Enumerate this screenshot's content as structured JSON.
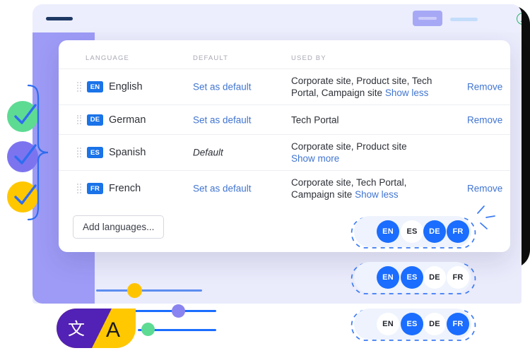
{
  "browser": {
    "logo_icon": "nav-logo-placeholder",
    "primary_button_icon": "primary-action-placeholder",
    "secondary_line_icon": "secondary-link-placeholder",
    "avatar_icon": "user-avatar-icon"
  },
  "card": {
    "columns": {
      "language": "LANGUAGE",
      "default": "DEFAULT",
      "used_by": "USED BY"
    },
    "rows": [
      {
        "code": "EN",
        "name": "English",
        "default_label": "Set as default",
        "default_is_current": false,
        "used_by": "Corporate site, Product site, Tech Portal, Campaign site",
        "toggle_label": "Show less",
        "remove_label": "Remove",
        "has_remove": true
      },
      {
        "code": "DE",
        "name": "German",
        "default_label": "Set as default",
        "default_is_current": false,
        "used_by": "Tech Portal",
        "toggle_label": "",
        "remove_label": "Remove",
        "has_remove": true
      },
      {
        "code": "ES",
        "name": "Spanish",
        "default_label": "Default",
        "default_is_current": true,
        "used_by": "Corporate site, Product site",
        "toggle_label": "Show more",
        "remove_label": "",
        "has_remove": false
      },
      {
        "code": "FR",
        "name": "French",
        "default_label": "Set as default",
        "default_is_current": false,
        "used_by": "Corporate site, Tech Portal, Campaign site",
        "toggle_label": "Show less",
        "remove_label": "Remove",
        "has_remove": true
      }
    ],
    "add_languages_label": "Add languages..."
  },
  "checks": [
    {
      "icon": "check-circle-icon",
      "color": "#5ddb93"
    },
    {
      "icon": "check-circle-icon",
      "color": "#7c74ef"
    },
    {
      "icon": "check-circle-icon",
      "color": "#ffc700"
    }
  ],
  "sliders": [
    {
      "icon": "slider-knob-icon",
      "color": "#ffc400"
    },
    {
      "icon": "slider-knob-icon",
      "color": "#8a84f0"
    },
    {
      "icon": "slider-knob-icon",
      "color": "#5ddb93"
    }
  ],
  "translate_icon": {
    "icon": "translate-icon",
    "left_glyph": "文",
    "right_glyph": "A",
    "left_color": "#5221b5",
    "right_color": "#ffc800"
  },
  "pill_groups": [
    {
      "name": "corporate-site-languages",
      "pills": [
        {
          "code": "EN",
          "active": true
        },
        {
          "code": "ES",
          "active": false
        },
        {
          "code": "DE",
          "active": true
        },
        {
          "code": "FR",
          "active": true
        }
      ]
    },
    {
      "name": "product-site-languages",
      "pills": [
        {
          "code": "EN",
          "active": true
        },
        {
          "code": "ES",
          "active": true
        },
        {
          "code": "DE",
          "active": false
        },
        {
          "code": "FR",
          "active": false
        }
      ]
    },
    {
      "name": "campaign-site-languages",
      "pills": [
        {
          "code": "EN",
          "active": false
        },
        {
          "code": "ES",
          "active": true
        },
        {
          "code": "DE",
          "active": false
        },
        {
          "code": "FR",
          "active": true
        }
      ]
    }
  ],
  "colors": {
    "accent_blue": "#1a6dff",
    "link_blue": "#4175d1",
    "sidebar_purple": "#9d9bf5",
    "panel_lavender": "#eaebfb"
  }
}
